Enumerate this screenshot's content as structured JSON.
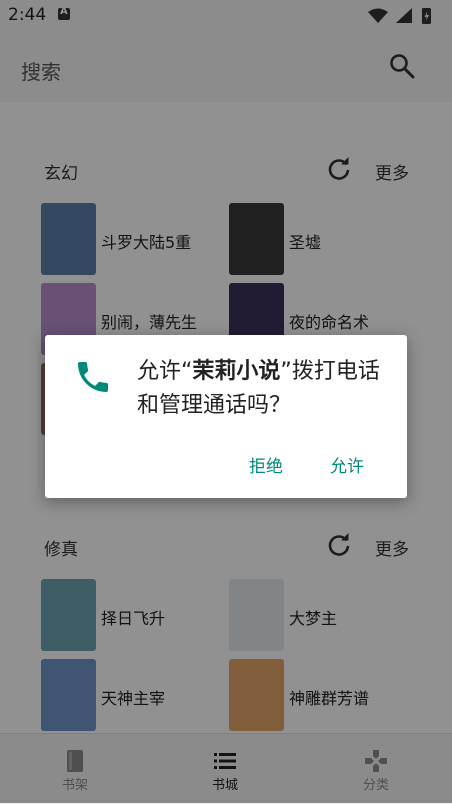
{
  "status_bar": {
    "time": "2:44",
    "notification_glyph": "A"
  },
  "search": {
    "placeholder": "搜索"
  },
  "sections": [
    {
      "title": "玄幻",
      "more_label": "更多",
      "books": [
        {
          "title": "斗罗大陆5重",
          "cover_color": "#5a7fa8"
        },
        {
          "title": "圣墟",
          "cover_color": "#3a3a3a"
        },
        {
          "title": "别闹，薄先生",
          "cover_color": "#b48cc8"
        },
        {
          "title": "夜的命名术",
          "cover_color": "#3b2f5a"
        }
      ]
    },
    {
      "title": "修真",
      "more_label": "更多",
      "books": [
        {
          "title": "择日飞升",
          "cover_color": "#6aa3b0"
        },
        {
          "title": "大梦主",
          "cover_color": "#dfe6e8"
        },
        {
          "title": "天神主宰",
          "cover_color": "#6f93c6"
        },
        {
          "title": "神雕群芳谱",
          "cover_color": "#e0a36a"
        }
      ]
    }
  ],
  "bottom_nav": [
    {
      "label": "书架",
      "icon": "book-icon",
      "active": false
    },
    {
      "label": "书城",
      "icon": "list-icon",
      "active": true
    },
    {
      "label": "分类",
      "icon": "gamepad-icon",
      "active": false
    }
  ],
  "dialog": {
    "message_prefix": "允许“",
    "app_name": "茉莉小说",
    "message_suffix": "”拨打电话和管理通话吗？",
    "deny_label": "拒绝",
    "allow_label": "允许",
    "icon": "phone-icon"
  },
  "colors": {
    "dialog_accent": "#00897b",
    "scrim": "rgba(0,0,0,0.42)"
  }
}
